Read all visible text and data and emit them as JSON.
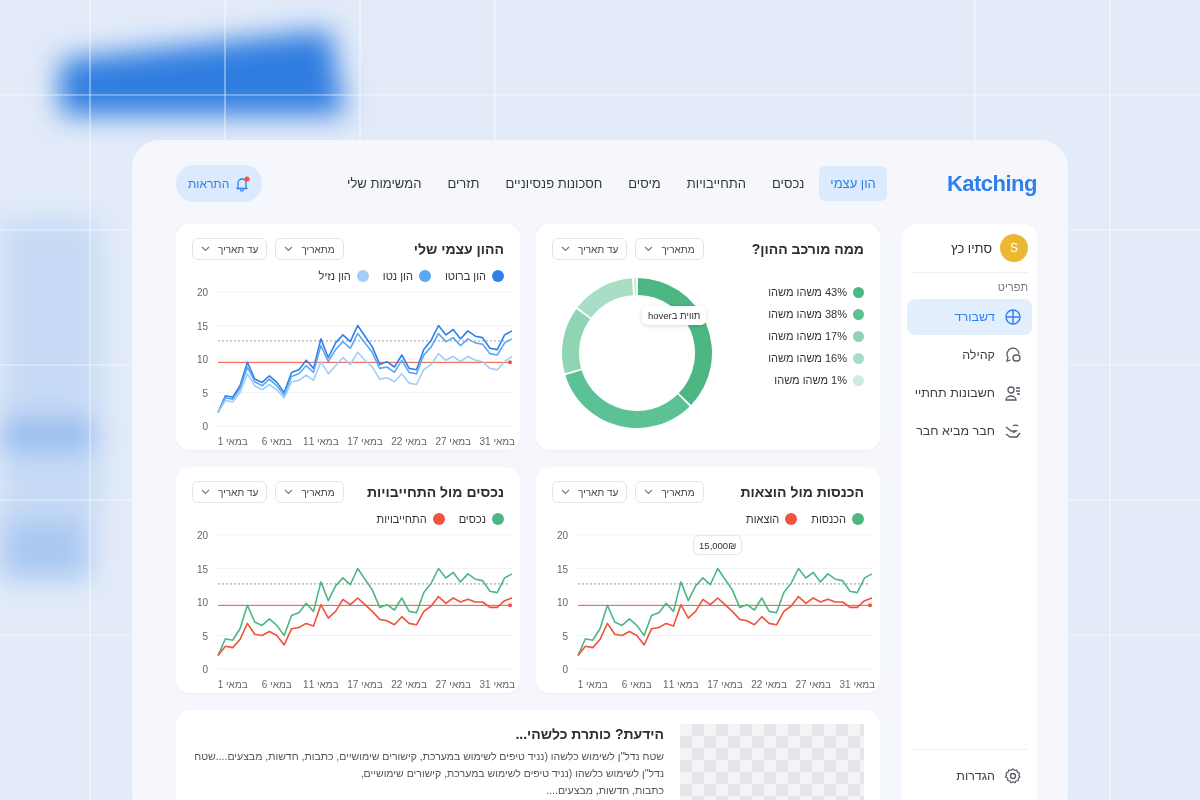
{
  "logo": "Katching",
  "nav": [
    {
      "label": "הון עצמי",
      "selected": true
    },
    {
      "label": "נכסים",
      "selected": false
    },
    {
      "label": "התחייבויות",
      "selected": false
    },
    {
      "label": "מיסים",
      "selected": false
    },
    {
      "label": "חסכונות פנסיוניים",
      "selected": false
    },
    {
      "label": "תזרים",
      "selected": false
    },
    {
      "label": "המשימות שלי",
      "selected": false
    }
  ],
  "notifications": {
    "label": "התראות",
    "unread": true
  },
  "sidebar": {
    "user": {
      "name": "סתיו כץ",
      "initial": "S"
    },
    "section": "תפריט",
    "items": [
      {
        "label": "דשבורד",
        "selected": true
      },
      {
        "label": "קהילה",
        "selected": false
      },
      {
        "label": "חשבונות תחתיי",
        "selected": false
      },
      {
        "label": "חבר מביא חבר",
        "selected": false
      }
    ],
    "settings": "הגדרות"
  },
  "cards": [
    {
      "title": "ממה מורכב ההון?",
      "filters": [
        "מתאריך",
        "עד תאריך"
      ],
      "chart_data": {
        "type": "donut",
        "legend": "right",
        "categories": [
          "43% משהו משהו",
          "38% משהו משהו",
          "17% משהו משהו",
          "16% משהו משהו",
          "1% משהו משהו"
        ],
        "values": [
          43,
          38,
          17,
          16,
          1
        ],
        "colors": [
          "#4cb782",
          "#5cc194",
          "#8fd4b3",
          "#a8dec5",
          "#cdecdd"
        ],
        "annotations": [
          {
            "text": "תווית בhover"
          }
        ]
      }
    },
    {
      "title": "ההון עצמי שלי",
      "filters": [
        "מתאריך",
        "עד תאריך"
      ],
      "chart_data": {
        "type": "line",
        "legend": "top",
        "categories": [
          null,
          null,
          "1 במאי",
          null,
          null,
          null,
          null,
          null,
          "6 במאי",
          null,
          null,
          null,
          null,
          null,
          "11 במאי",
          null,
          null,
          null,
          null,
          null,
          "17 במאי",
          null,
          null,
          null,
          null,
          null,
          "22 במאי",
          null,
          null,
          null,
          null,
          null,
          "27 במאי",
          null,
          null,
          null,
          null,
          null,
          "31 במאי",
          null,
          null
        ],
        "ylim": [
          0,
          20
        ],
        "yticks": [
          0,
          5,
          10,
          15,
          20
        ],
        "series": [
          {
            "name": "הון ברוטו",
            "color": "#2f80ed",
            "values": [
              2,
              4.5,
              4.3,
              6,
              9.5,
              7,
              6.5,
              7.5,
              6.5,
              5,
              8,
              8.4,
              9.8,
              8.6,
              13,
              10.2,
              12.4,
              13.6,
              12.6,
              15,
              13.4,
              11.8,
              9.2,
              9.6,
              8.8,
              10.6,
              8.6,
              8.4,
              11.4,
              12.8,
              15,
              13.6,
              14.4,
              13,
              14.2,
              13.4,
              13.2,
              11.6,
              11.4,
              13.6,
              14.2
            ]
          },
          {
            "name": "הון נטו",
            "color": "#5aa9f0",
            "values": [
              2,
              4.2,
              4,
              5.6,
              8.8,
              6.6,
              6,
              7,
              6,
              4.6,
              7.4,
              7.8,
              9,
              8,
              12,
              9.6,
              11.4,
              12.6,
              11.6,
              13.8,
              12.4,
              11,
              8.6,
              8.8,
              8,
              9.8,
              8,
              7.8,
              10.6,
              11.8,
              13.8,
              12.6,
              13.2,
              12,
              13,
              12.4,
              12.2,
              10.8,
              10.6,
              12.4,
              13
            ]
          },
          {
            "name": "הון נזיל",
            "color": "#a3cdf7",
            "values": [
              2,
              3.8,
              3.6,
              5,
              7.8,
              6,
              5.4,
              6.2,
              5.4,
              4.2,
              6.6,
              6.8,
              7.6,
              6.8,
              9.6,
              7.8,
              9,
              10.2,
              9.2,
              11,
              9.8,
              8.8,
              7,
              7.2,
              6.6,
              7.8,
              6.4,
              6.2,
              8.4,
              9.2,
              10.8,
              9.8,
              10.4,
              9.6,
              10.4,
              9.8,
              9.6,
              8.6,
              8.4,
              9.6,
              10.4
            ]
          }
        ],
        "grid": true,
        "ref_lines": [
          {
            "axis": "y",
            "value": 12.7,
            "color": "#9a9a9a"
          },
          {
            "axis": "y",
            "value": 9.5,
            "color": "#f0533a"
          }
        ]
      }
    },
    {
      "title": "הכנסות מול הוצאות",
      "filters": [
        "מתאריך",
        "עד תאריך"
      ],
      "chart_data": {
        "type": "line",
        "legend": "top",
        "categories": [
          null,
          null,
          "1 במאי",
          null,
          null,
          null,
          null,
          null,
          "6 במאי",
          null,
          null,
          null,
          null,
          null,
          "11 במאי",
          null,
          null,
          null,
          null,
          null,
          "17 במאי",
          null,
          null,
          null,
          null,
          null,
          "22 במאי",
          null,
          null,
          null,
          null,
          null,
          "27 במאי",
          null,
          null,
          null,
          null,
          null,
          "31 במאי",
          null,
          null
        ],
        "ylim": [
          0,
          20
        ],
        "yticks": [
          0,
          5,
          10,
          15,
          20
        ],
        "series": [
          {
            "name": "הכנסות",
            "color": "#4cb782",
            "values": [
              2,
              4.5,
              4.3,
              6,
              9.5,
              7,
              6.5,
              7.5,
              6.5,
              5,
              8,
              8.4,
              9.8,
              8.6,
              13,
              10.2,
              12.4,
              13.6,
              12.6,
              15,
              13.4,
              11.8,
              9.2,
              9.6,
              8.8,
              10.6,
              8.6,
              8.4,
              11.4,
              12.8,
              15,
              13.6,
              14.4,
              13,
              14.2,
              13.4,
              13.2,
              11.6,
              11.4,
              13.6,
              14.2
            ]
          },
          {
            "name": "הוצאות",
            "color": "#f0533a",
            "values": [
              2,
              3.4,
              3.2,
              4.4,
              6.8,
              5.2,
              5,
              5.6,
              5,
              3.6,
              6,
              6.2,
              6.8,
              6.4,
              9.6,
              7.6,
              8.6,
              10.4,
              9.6,
              10.6,
              9.6,
              8.6,
              7.4,
              7.2,
              6.6,
              7.8,
              6.8,
              6.6,
              8.6,
              9.4,
              10.8,
              9.8,
              10.6,
              10,
              10.4,
              10,
              10,
              9.2,
              9.2,
              10.2,
              10.6
            ]
          }
        ],
        "grid": true,
        "ref_lines": [
          {
            "axis": "y",
            "value": 12.7,
            "color": "#9a9a9a"
          },
          {
            "axis": "y",
            "value": 9.5,
            "color": "#f0533a"
          }
        ],
        "annotations": [
          {
            "text": "15,000₪"
          }
        ]
      }
    },
    {
      "title": "נכסים מול התחייבויות",
      "filters": [
        "מתאריך",
        "עד תאריך"
      ],
      "chart_data": {
        "type": "line",
        "legend": "top",
        "categories": [
          null,
          null,
          "1 במאי",
          null,
          null,
          null,
          null,
          null,
          "6 במאי",
          null,
          null,
          null,
          null,
          null,
          "11 במאי",
          null,
          null,
          null,
          null,
          null,
          "17 במאי",
          null,
          null,
          null,
          null,
          null,
          "22 במאי",
          null,
          null,
          null,
          null,
          null,
          "27 במאי",
          null,
          null,
          null,
          null,
          null,
          "31 במאי",
          null,
          null
        ],
        "ylim": [
          0,
          20
        ],
        "yticks": [
          0,
          5,
          10,
          15,
          20
        ],
        "series": [
          {
            "name": "נכסים",
            "color": "#4cb782",
            "values": [
              2,
              4.5,
              4.3,
              6,
              9.5,
              7,
              6.5,
              7.5,
              6.5,
              5,
              8,
              8.4,
              9.8,
              8.6,
              13,
              10.2,
              12.4,
              13.6,
              12.6,
              15,
              13.4,
              11.8,
              9.2,
              9.6,
              8.8,
              10.6,
              8.6,
              8.4,
              11.4,
              12.8,
              15,
              13.6,
              14.4,
              13,
              14.2,
              13.4,
              13.2,
              11.6,
              11.4,
              13.6,
              14.2
            ]
          },
          {
            "name": "התחייבויות",
            "color": "#f0533a",
            "values": [
              2,
              3.4,
              3.2,
              4.4,
              6.8,
              5.2,
              5,
              5.6,
              5,
              3.6,
              6,
              6.2,
              6.8,
              6.4,
              9.6,
              7.6,
              8.6,
              10.4,
              9.6,
              10.6,
              9.6,
              8.6,
              7.4,
              7.2,
              6.6,
              7.8,
              6.8,
              6.6,
              8.6,
              9.4,
              10.8,
              9.8,
              10.6,
              10,
              10.4,
              10,
              10,
              9.2,
              9.2,
              10.2,
              10.6
            ]
          }
        ],
        "grid": true,
        "ref_lines": [
          {
            "axis": "y",
            "value": 12.7,
            "color": "#9a9a9a"
          },
          {
            "axis": "y",
            "value": 9.5,
            "color": "#f0533a"
          }
        ]
      }
    }
  ],
  "article": {
    "title": "הידעת? כותרת כלשהי...",
    "lines": [
      "שטח נדל\"ן לשימוש כלשהו (נניד טיפים לשימוש במערכת, קישורים שימושיים, כתבות, חדשות, מבצעים....שטח נדל\"ן לשימוש כלשהו (נניד טיפים לשימוש במערכת, קישורים שימושיים,",
      "כתבות, חדשות, מבצעים...."
    ]
  }
}
